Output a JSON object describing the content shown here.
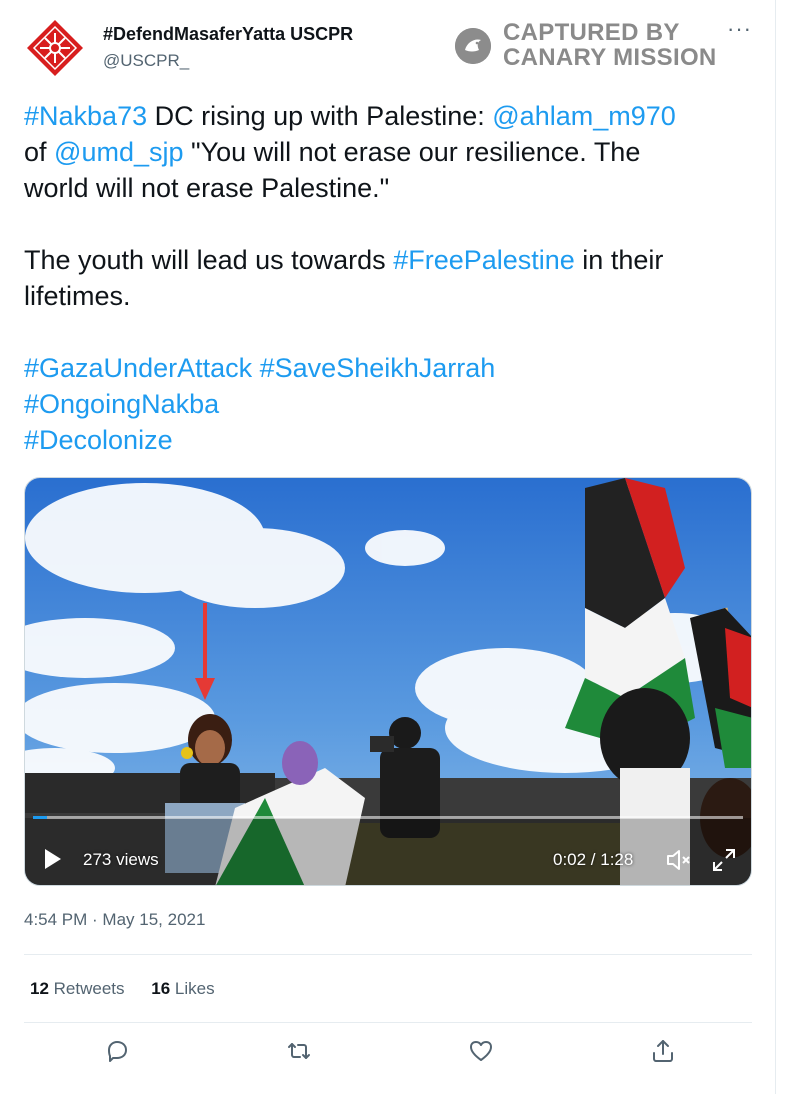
{
  "account": {
    "display_name": "#DefendMasaferYatta USCPR",
    "handle": "@USCPR_",
    "avatar_icon": "star-pattern-avatar-icon"
  },
  "watermark": {
    "line1": "CAPTURED BY",
    "line2": "CANARY MISSION",
    "icon": "canary-bird-icon"
  },
  "more_label": "···",
  "tweet": {
    "lines": [
      [
        {
          "text": "#Nakba73",
          "link": true
        },
        {
          "text": " DC rising up with Palestine: ",
          "link": false
        },
        {
          "text": "@ahlam_m970",
          "link": true
        }
      ],
      [
        {
          "text": "of ",
          "link": false
        },
        {
          "text": "@umd_sjp",
          "link": true
        },
        {
          "text": " \"You will not erase our resilience. The",
          "link": false
        }
      ],
      [
        {
          "text": "world will not erase Palestine.\"",
          "link": false
        }
      ],
      [],
      [
        {
          "text": "The youth will lead us towards ",
          "link": false
        },
        {
          "text": "#FreePalestine",
          "link": true
        },
        {
          "text": " in their",
          "link": false
        }
      ],
      [
        {
          "text": "lifetimes.",
          "link": false
        }
      ],
      [],
      [
        {
          "text": "#GazaUnderAttack",
          "link": true
        },
        {
          "text": " ",
          "link": false
        },
        {
          "text": "#SaveSheikhJarrah",
          "link": true
        }
      ],
      [
        {
          "text": "#OngoingNakba",
          "link": true
        }
      ],
      [
        {
          "text": "#Decolonize",
          "link": true
        }
      ]
    ]
  },
  "video": {
    "views": "273 views",
    "time": "0:02 / 1:28",
    "progress": 0.02
  },
  "timestamp": "4:54 PM · May 15, 2021",
  "stats": {
    "retweets_count": "12",
    "retweets_label": "Retweets",
    "likes_count": "16",
    "likes_label": "Likes"
  },
  "actions": [
    "reply-icon",
    "retweet-icon",
    "like-icon",
    "share-icon"
  ],
  "colors": {
    "link": "#1d9bf0",
    "secondary_text": "#536471",
    "watermark": "#8a8a8a"
  }
}
